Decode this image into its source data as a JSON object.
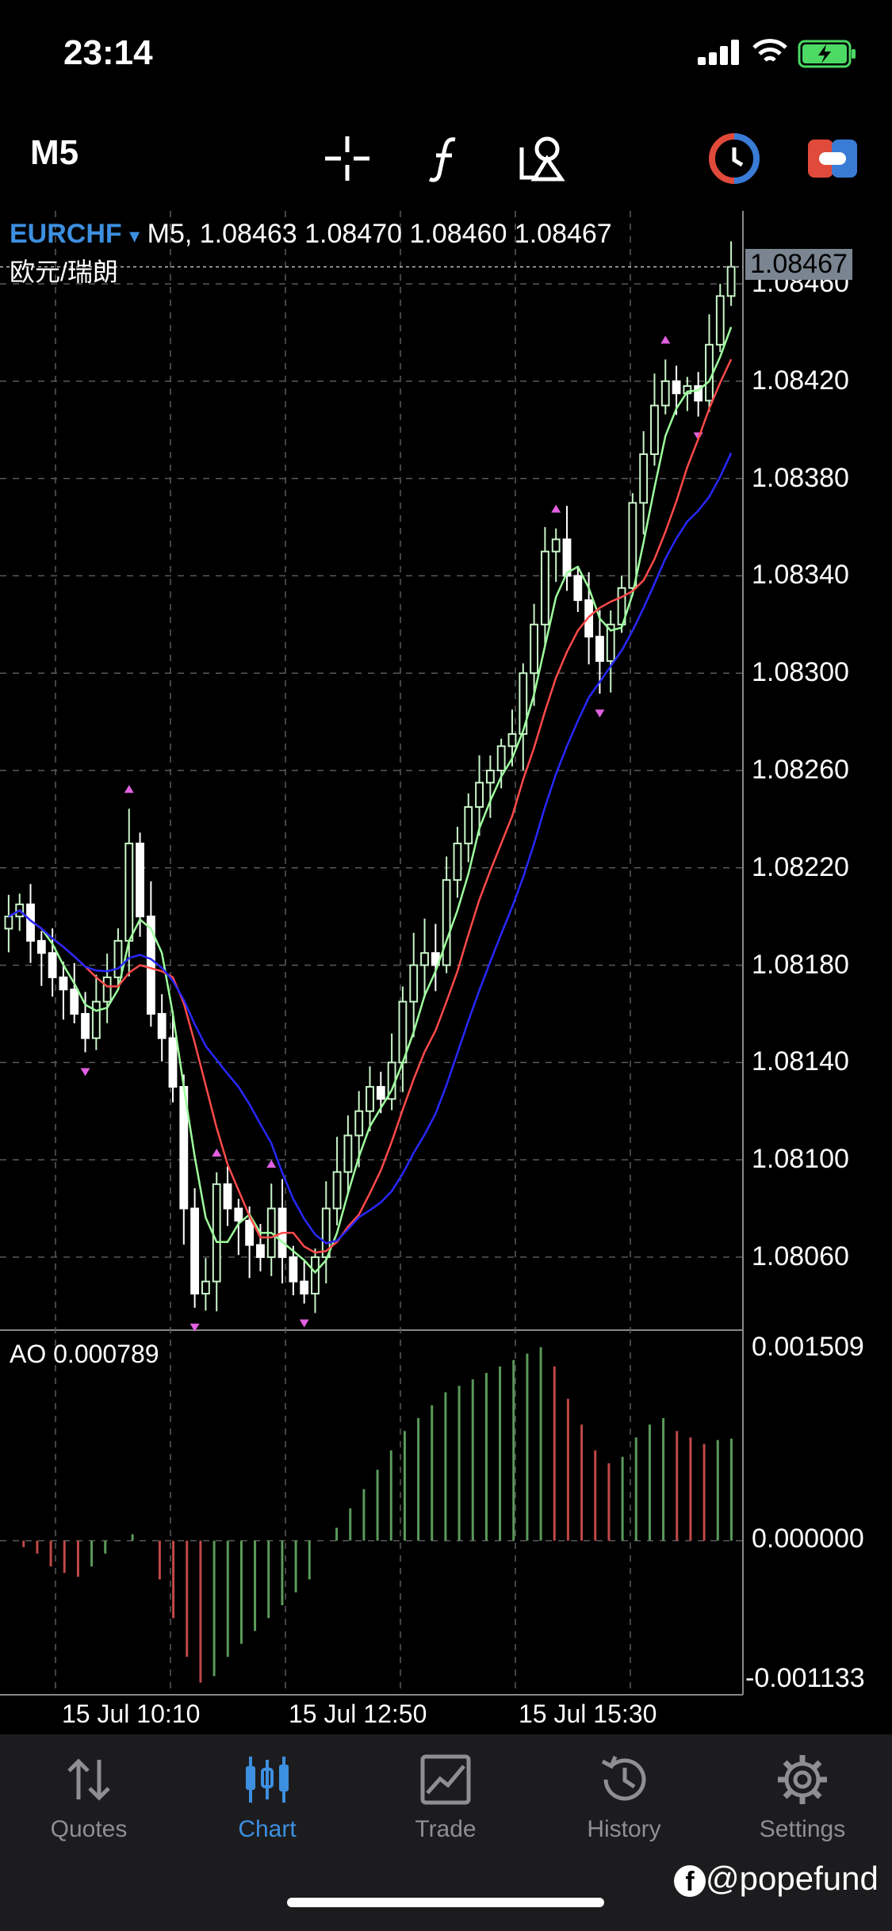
{
  "status": {
    "time": "23:14"
  },
  "toolbar": {
    "timeframe": "M5",
    "icons": [
      "crosshair-icon",
      "function-icon",
      "objects-icon",
      "timeframe-switch-icon",
      "trade-toggle-icon"
    ]
  },
  "chart": {
    "symbol": "EURCHF",
    "symbol_arrow": "▾",
    "ohlc_text": "M5, 1.08463 1.08470 1.08460 1.08467",
    "description": "欧元/瑞朗",
    "current_price": "1.08467",
    "price_axis": [
      "1.08460",
      "1.08420",
      "1.08380",
      "1.08340",
      "1.08300",
      "1.08260",
      "1.08220",
      "1.08180",
      "1.08140",
      "1.08100",
      "1.08060"
    ],
    "ao_label": "AO 0.000789",
    "ao_axis": [
      "0.001509",
      "0.000000",
      "-0.001133"
    ],
    "time_axis": [
      "15 Jul 10:10",
      "15 Jul 12:50",
      "15 Jul 15:30"
    ],
    "colors": {
      "bull": "#c8f5c8",
      "bear": "#ffffff",
      "ma_fast": "#9dff9d",
      "ma_mid": "#ff4a4a",
      "ma_slow": "#2828ff",
      "fractal": "#e060e0",
      "ao_up": "#5a9a5a",
      "ao_down": "#c04848",
      "grid": "#5a5a5a"
    }
  },
  "chart_data": {
    "type": "candlestick",
    "symbol": "EURCHF",
    "timeframe": "M5",
    "ylim": [
      1.0803,
      1.0849
    ],
    "close_series": [
      1.082,
      1.08205,
      1.0819,
      1.08185,
      1.08175,
      1.0817,
      1.0816,
      1.0815,
      1.08165,
      1.08175,
      1.0819,
      1.0823,
      1.082,
      1.0816,
      1.0815,
      1.0813,
      1.0808,
      1.08045,
      1.0805,
      1.0809,
      1.0808,
      1.08075,
      1.08065,
      1.0806,
      1.0808,
      1.0806,
      1.0805,
      1.08045,
      1.0806,
      1.0808,
      1.08095,
      1.0811,
      1.0812,
      1.0813,
      1.08125,
      1.0814,
      1.08165,
      1.0818,
      1.08185,
      1.0818,
      1.08215,
      1.0823,
      1.08245,
      1.08255,
      1.0826,
      1.0827,
      1.08275,
      1.083,
      1.0832,
      1.0835,
      1.08355,
      1.0834,
      1.0833,
      1.08315,
      1.08305,
      1.0832,
      1.08335,
      1.0837,
      1.0839,
      1.0841,
      1.0842,
      1.08415,
      1.08418,
      1.08412,
      1.08435,
      1.08455,
      1.08467
    ],
    "ao_series": [
      0.0,
      -5e-05,
      -0.0001,
      -0.0002,
      -0.00025,
      -0.00028,
      -0.0002,
      -0.0001,
      0.0,
      5e-05,
      0.0,
      -0.0003,
      -0.0006,
      -0.0009,
      -0.0011,
      -0.00105,
      -0.0009,
      -0.0008,
      -0.0007,
      -0.0006,
      -0.0005,
      -0.0004,
      -0.0003,
      0.0,
      0.0001,
      0.00025,
      0.0004,
      0.00055,
      0.0007,
      0.00085,
      0.00095,
      0.00105,
      0.00115,
      0.0012,
      0.00125,
      0.0013,
      0.00135,
      0.0014,
      0.00145,
      0.0015,
      0.00135,
      0.0011,
      0.0009,
      0.0007,
      0.0006,
      0.00065,
      0.0008,
      0.0009,
      0.00095,
      0.00085,
      0.0008,
      0.00075,
      0.00078,
      0.00079
    ],
    "ao_ylim": [
      -0.001133,
      0.001509
    ]
  },
  "nav": {
    "items": [
      {
        "label": "Quotes",
        "icon": "quotes-icon",
        "active": false
      },
      {
        "label": "Chart",
        "icon": "chart-icon",
        "active": true
      },
      {
        "label": "Trade",
        "icon": "trade-icon",
        "active": false
      },
      {
        "label": "History",
        "icon": "history-icon",
        "active": false
      },
      {
        "label": "Settings",
        "icon": "settings-icon",
        "active": false
      }
    ]
  },
  "watermark": "@popefund"
}
